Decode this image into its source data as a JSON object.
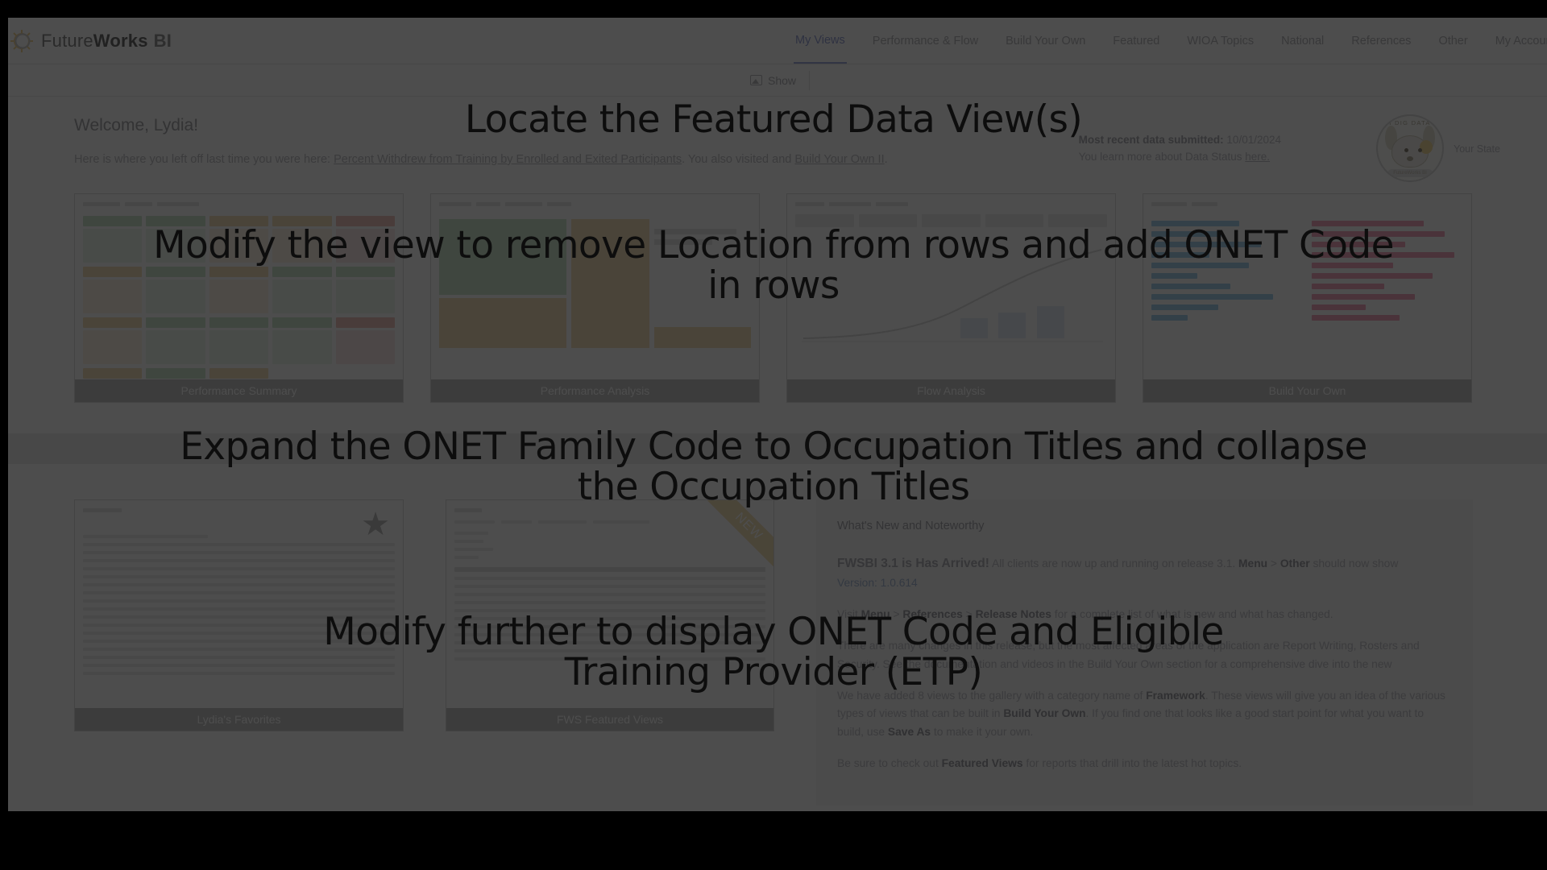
{
  "brand": {
    "part1": "Future",
    "part2": "Works",
    "part3": "BI",
    "gear_icon": "gear-sun-icon"
  },
  "nav": {
    "items": [
      {
        "label": "My Views",
        "active": true
      },
      {
        "label": "Performance & Flow",
        "active": false
      },
      {
        "label": "Build Your Own",
        "active": false
      },
      {
        "label": "Featured",
        "active": false
      },
      {
        "label": "WIOA Topics",
        "active": false
      },
      {
        "label": "National",
        "active": false
      },
      {
        "label": "References",
        "active": false
      },
      {
        "label": "Other",
        "active": false
      },
      {
        "label": "My Account",
        "active": false
      }
    ]
  },
  "toolbar": {
    "show_label": "Show",
    "show_icon": "image-icon"
  },
  "welcome": {
    "title": "Welcome, Lydia!",
    "sub_prefix": "Here is where you left off last time you were here: ",
    "link1": "Percent Withdrew from Training by Enrolled and Exited Participants",
    "sub_middle": ". You also visited and ",
    "link2": "Build Your Own II",
    "sub_suffix": "."
  },
  "status": {
    "label": "Most recent data submitted:",
    "date": "10/01/2024",
    "status_prefix": "You learn more about Data Status ",
    "status_link": "here.",
    "badge_ring_text": "I DIG DATA",
    "badge_foot_text": "FutureWorks BI",
    "state_label": "Your State"
  },
  "cards_top": [
    {
      "label": "Performance Summary",
      "thumb": "performance-summary-thumbnail"
    },
    {
      "label": "Performance Analysis",
      "thumb": "performance-analysis-thumbnail"
    },
    {
      "label": "Flow Analysis",
      "thumb": "flow-analysis-thumbnail"
    },
    {
      "label": "Build Your Own",
      "thumb": "build-your-own-thumbnail"
    }
  ],
  "cards_bottom": [
    {
      "label": "Lydia's Favorites",
      "badge": "star-icon",
      "thumb": "favorites-thumbnail"
    },
    {
      "label": "FWS Featured Views",
      "badge": "NEW",
      "thumb": "featured-views-thumbnail"
    }
  ],
  "whats_new": {
    "heading": "What's New and Noteworthy",
    "p1_title": "FWSBI 3.1 is Has Arrived!",
    "p1_a": " All clients are now up and running on release 3.1. ",
    "p1_menu": "Menu",
    "p1_sep": " > ",
    "p1_other": "Other",
    "p1_b": " should now show",
    "version": "Version: 1.0.614",
    "p2_a": "Visit ",
    "p2_menu": "Menu",
    "p2_sep1": " > ",
    "p2_ref": "References",
    "p2_sep2": " > ",
    "p2_rel": "Release Notes",
    "p2_b": " for a complete list of what is new and what has changed.",
    "p3": "There are many changes in this release, but the most affected areas of the application are Report Writing, Rosters and Security. See the documentation and videos in the Build Your Own section for a comprehensive dive into the new",
    "p4_a": "We have added 8 views to the gallery with a category name of ",
    "p4_framework": "Framework",
    "p4_b": ".  These views will give you an idea of the various types of views that can be built in ",
    "p4_byo": "Build Your Own",
    "p4_c": ".  If you find one that looks like a good start point for what you want to build, use ",
    "p4_saveas": "Save As",
    "p4_d": " to make it your own.",
    "p5_a": "Be sure to check out ",
    "p5_featured": "Featured Views",
    "p5_b": " for reports that drill into the latest hot topics."
  },
  "overlay_instructions": {
    "line1": "Locate the Featured Data View(s)",
    "line2": "Modify the view to remove Location from rows and add ONET Code in rows",
    "line3": "Expand the ONET Family Code to Occupation Titles and collapse the Occupation Titles",
    "line4": "Modify further to display ONET Code and Eligible Training Provider (ETP)"
  },
  "colors": {
    "accent": "#9aa4d8",
    "card_label_bg": "#c8c8c8",
    "ribbon": "#f6e4ba",
    "overlay_text": "#0d0d0d"
  }
}
